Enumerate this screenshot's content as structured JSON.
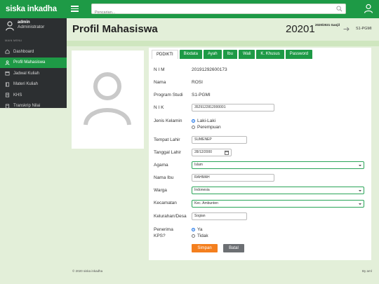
{
  "app": {
    "brand": "siska inkadha"
  },
  "search": {
    "placeholder": "Pencarian..."
  },
  "sidebar": {
    "username": "admin",
    "role": "Administrator",
    "section": "MAIN MENU",
    "items": [
      {
        "label": "Dashboard",
        "icon": "home-icon"
      },
      {
        "label": "Profil Mahasiswa",
        "icon": "user-icon",
        "active": true
      },
      {
        "label": "Jadwal Kuliah",
        "icon": "calendar-icon"
      },
      {
        "label": "Materi Kuliah",
        "icon": "book-icon"
      },
      {
        "label": "KHS",
        "icon": "document-icon"
      },
      {
        "label": "Transkrip Nilai",
        "icon": "document-icon"
      }
    ]
  },
  "header": {
    "title": "Profil Mahasiswa",
    "nim_short": "20201",
    "semester": "2020/2021 Ganjil",
    "prodi": "S1-PGMI"
  },
  "tabs": [
    "PDDIKTI",
    "Biodata",
    "Ayah",
    "Ibu",
    "Wali",
    "K. Khusus",
    "Password"
  ],
  "form": {
    "nim_label": "N I M",
    "nim": "20191292600173",
    "nama_label": "Nama",
    "nama": "ROSI",
    "prodi_label": "Program Studi",
    "prodi": "S1-PGMI",
    "nik_label": "N I K",
    "nik": "3529122812000001",
    "jk_label": "Jenis Kelamin",
    "jk_options": [
      "Laki-Laki",
      "Perempuan"
    ],
    "tempat_label": "Tempat Lahir",
    "tempat": "SUMENEP",
    "tanggal_label": "Tanggal Lahir",
    "tanggal": "28/12/2000",
    "agama_label": "Agama",
    "agama": "Islam",
    "ibu_label": "Nama Ibu",
    "ibu": "RAHMAH",
    "warga_label": "Warga",
    "warga": "Indonesia",
    "kec_label": "Kecamatan",
    "kec": "Kec. Ambunten",
    "kel_label": "Kelurahan/Desa",
    "kel": "Sogian",
    "kps_label_1": "Penerima",
    "kps_label_2": "KPS?",
    "kps_options": [
      "Ya",
      "Tidak"
    ],
    "save": "Simpan",
    "cancel": "Batal"
  },
  "footer": {
    "left": "© 2020 siska inkadha",
    "right": "By aml"
  },
  "colors": {
    "primary": "#1e9a46",
    "sidebar": "#2c2f31",
    "save": "#f47f1e",
    "cancel": "#6c6f73",
    "bg": "#e3efd9"
  }
}
